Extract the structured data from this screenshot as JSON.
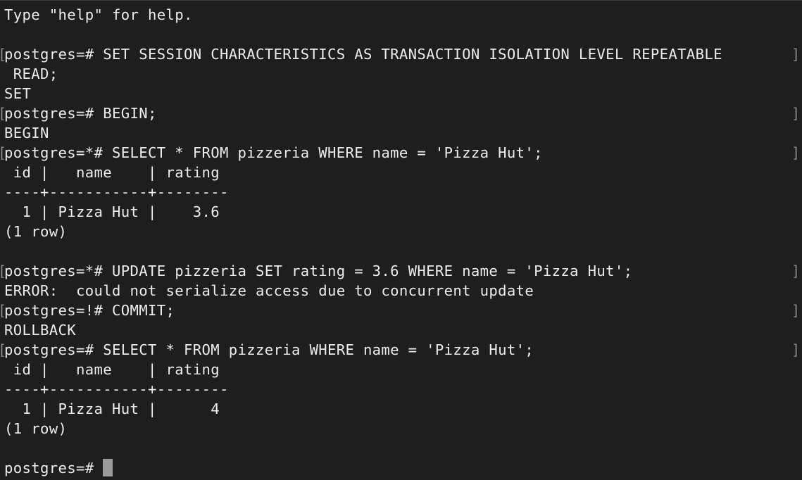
{
  "terminal": {
    "lines": [
      {
        "text": "Type \"help\" for help.",
        "mark_left": "",
        "mark_right": ""
      },
      {
        "text": "",
        "mark_left": "",
        "mark_right": ""
      },
      {
        "text": "postgres=# SET SESSION CHARACTERISTICS AS TRANSACTION ISOLATION LEVEL REPEATABLE",
        "mark_left": "[",
        "mark_right": "]"
      },
      {
        "text": " READ;",
        "mark_left": "",
        "mark_right": ""
      },
      {
        "text": "SET",
        "mark_left": "",
        "mark_right": ""
      },
      {
        "text": "postgres=# BEGIN;",
        "mark_left": "[",
        "mark_right": "]"
      },
      {
        "text": "BEGIN",
        "mark_left": "",
        "mark_right": ""
      },
      {
        "text": "postgres=*# SELECT * FROM pizzeria WHERE name = 'Pizza Hut';",
        "mark_left": "[",
        "mark_right": "]"
      },
      {
        "text": " id |   name    | rating",
        "mark_left": "",
        "mark_right": ""
      },
      {
        "text": "----+-----------+--------",
        "mark_left": "",
        "mark_right": ""
      },
      {
        "text": "  1 | Pizza Hut |    3.6",
        "mark_left": "",
        "mark_right": ""
      },
      {
        "text": "(1 row)",
        "mark_left": "",
        "mark_right": ""
      },
      {
        "text": "",
        "mark_left": "",
        "mark_right": ""
      },
      {
        "text": "postgres=*# UPDATE pizzeria SET rating = 3.6 WHERE name = 'Pizza Hut';",
        "mark_left": "[",
        "mark_right": "]"
      },
      {
        "text": "ERROR:  could not serialize access due to concurrent update",
        "mark_left": "",
        "mark_right": ""
      },
      {
        "text": "postgres=!# COMMIT;",
        "mark_left": "[",
        "mark_right": "]"
      },
      {
        "text": "ROLLBACK",
        "mark_left": "",
        "mark_right": ""
      },
      {
        "text": "postgres=# SELECT * FROM pizzeria WHERE name = 'Pizza Hut';",
        "mark_left": "[",
        "mark_right": "]"
      },
      {
        "text": " id |   name    | rating",
        "mark_left": "",
        "mark_right": ""
      },
      {
        "text": "----+-----------+--------",
        "mark_left": "",
        "mark_right": ""
      },
      {
        "text": "  1 | Pizza Hut |      4",
        "mark_left": "",
        "mark_right": ""
      },
      {
        "text": "(1 row)",
        "mark_left": "",
        "mark_right": ""
      },
      {
        "text": "",
        "mark_left": "",
        "mark_right": ""
      }
    ],
    "prompt": "postgres=# ",
    "colors": {
      "background": "#1e1e1e",
      "text": "#ececec",
      "cursor": "#9b9b9b"
    }
  }
}
